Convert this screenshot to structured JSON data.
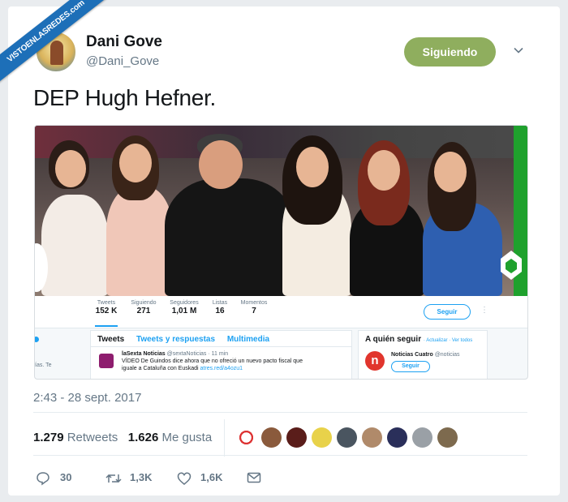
{
  "watermark": {
    "text": "VISTOENLASREDES",
    "suffix": ".com"
  },
  "author": {
    "name": "Dani Gove",
    "handle": "@Dani_Gove"
  },
  "follow_button": {
    "label": "Siguiendo"
  },
  "tweet": {
    "text": "DEP Hugh Hefner."
  },
  "embedded": {
    "stats": [
      {
        "label": "Tweets",
        "value": "152 K"
      },
      {
        "label": "Siguiendo",
        "value": "271"
      },
      {
        "label": "Seguidores",
        "value": "1,01 M"
      },
      {
        "label": "Listas",
        "value": "16"
      },
      {
        "label": "Momentos",
        "value": "7"
      }
    ],
    "seguir": "Seguir",
    "tabs": [
      "Tweets",
      "Tweets y respuestas",
      "Multimedia"
    ],
    "tl_item": {
      "name": "laSexta Noticias",
      "meta": "@sextaNoticias · 11 min",
      "line1": "VÍDEO De Guindos dice ahora que no ofreció un nuevo pacto fiscal que",
      "line2": "iguale a Cataluña con Euskadi",
      "link": "atres.red/a4ozu1"
    },
    "left_text": "ías. Te",
    "side": {
      "title": "A quién seguir",
      "links": "· Actualizar · Ver todos",
      "account_name": "Noticias Cuatro",
      "account_handle": "@noticias",
      "button": "Seguir",
      "icon_letter": "n"
    }
  },
  "timestamp": "2:43 - 28 sept. 2017",
  "engagement": {
    "retweets_count": "1.279",
    "retweets_label": "Retweets",
    "likes_count": "1.626",
    "likes_label": "Me gusta"
  },
  "actions": {
    "replies": "30",
    "retweets": "1,3K",
    "likes": "1,6K"
  },
  "colors": {
    "follow_bg": "#8fae5e",
    "link": "#1da1f2",
    "muted": "#657786",
    "ribbon": "#1d6fb8",
    "brand_green": "#1fa12d"
  }
}
